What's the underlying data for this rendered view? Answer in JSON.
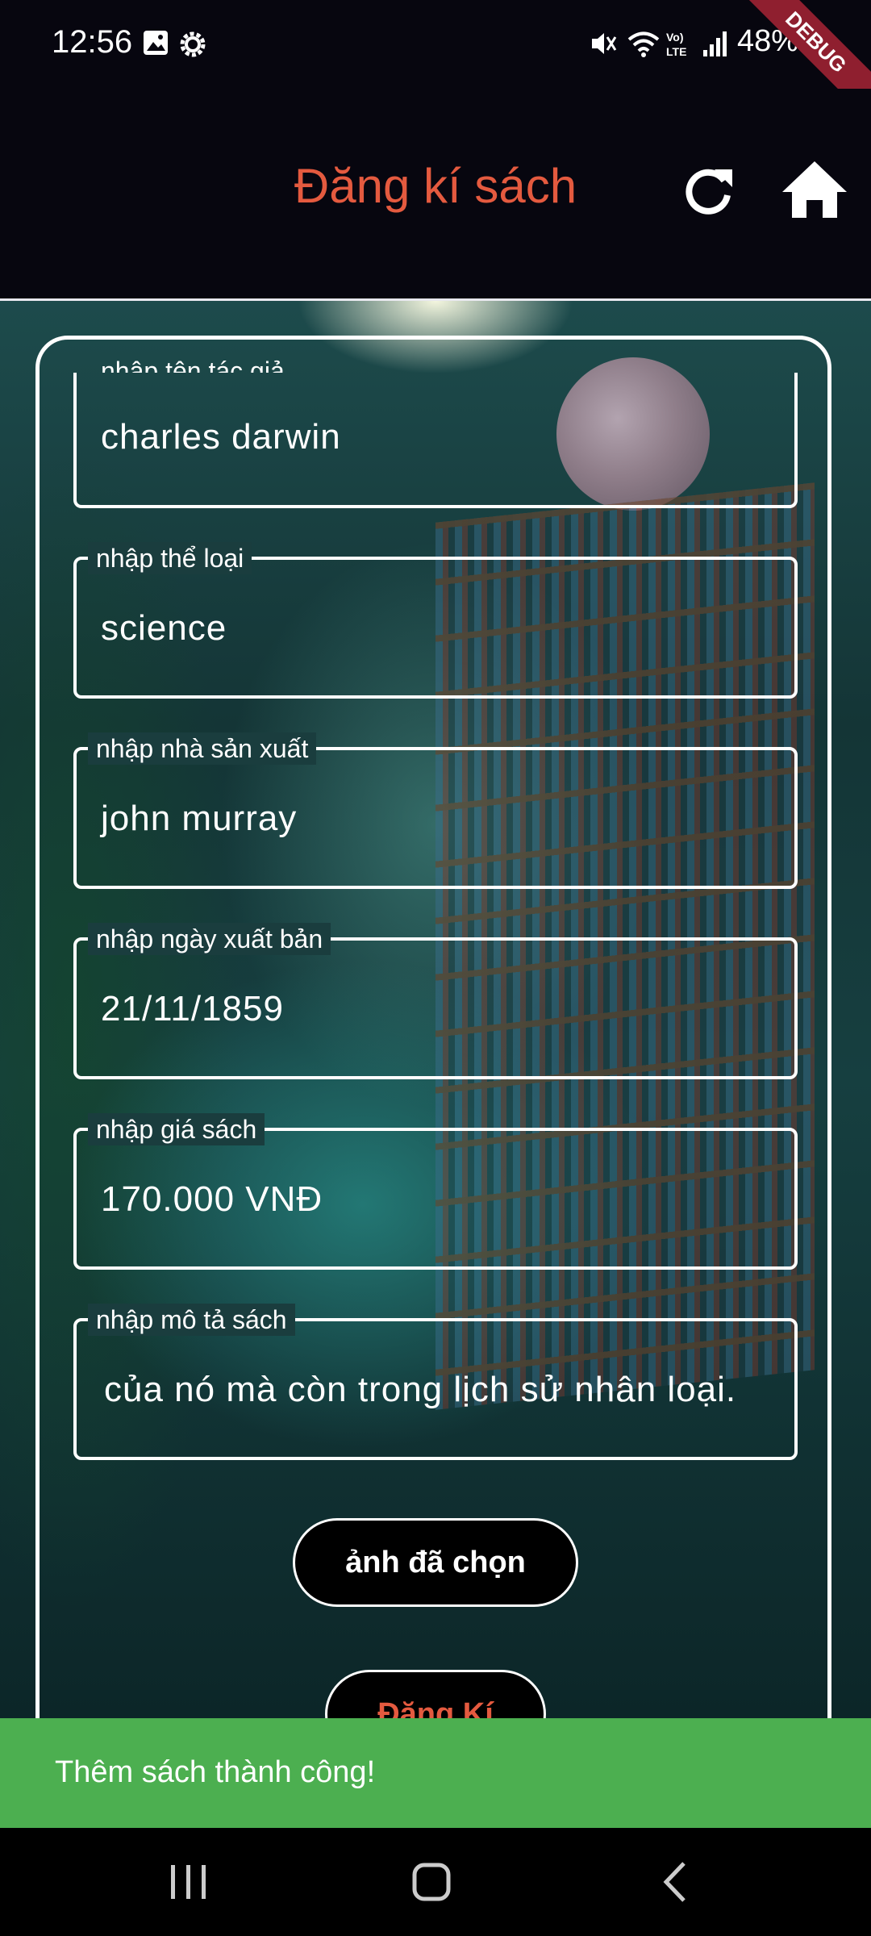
{
  "status_bar": {
    "time": "12:56",
    "battery": "48%",
    "debug_label": "DEBUG"
  },
  "app_bar": {
    "title": "Đăng kí sách",
    "refresh_icon": "refresh-icon",
    "home_icon": "home-icon"
  },
  "form": {
    "author": {
      "label": "nhập tên tác giả",
      "value": "charles darwin"
    },
    "genre": {
      "label": "nhập thể loại",
      "value": "science"
    },
    "publisher": {
      "label": "nhập nhà sản xuất",
      "value": "john murray"
    },
    "publish_date": {
      "label": "nhập ngày xuất bản",
      "value": "21/11/1859"
    },
    "price": {
      "label": "nhập giá sách",
      "value": "170.000 VNĐ"
    },
    "description": {
      "label": "nhập mô tả sách",
      "value": " của nó mà còn trong lịch sử nhân loại."
    },
    "image_button": "ảnh đã chọn",
    "submit_button": "Đăng Kí"
  },
  "snackbar": {
    "message": "Thêm sách thành công!"
  },
  "colors": {
    "title": "#e45a3f",
    "snackbar": "#4caf50",
    "background": "#07060f"
  }
}
